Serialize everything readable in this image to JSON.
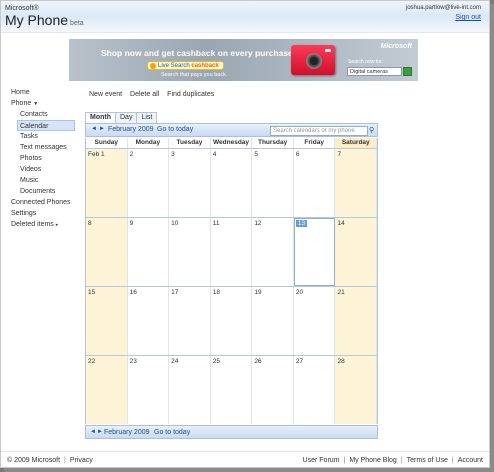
{
  "header": {
    "brand_prefix": "Microsoft®",
    "brand_name": "My Phone",
    "brand_tag": "beta",
    "user_email": "joshua.partlow@live-int.com",
    "signout": "Sign out"
  },
  "ad": {
    "headline": "Shop now and get cashback on every purchase.",
    "pill_prefix": "Live Search",
    "pill_suffix": "cashback",
    "tagline": "Search that pays you back.",
    "brand": "Microsoft",
    "search_label": "Search now for:",
    "search_value": "Digital cameras"
  },
  "sidebar": {
    "items": [
      {
        "label": "Home"
      },
      {
        "label": "Phone",
        "caret": "▼"
      },
      {
        "label": "Contacts"
      },
      {
        "label": "Calendar"
      },
      {
        "label": "Tasks"
      },
      {
        "label": "Text messages"
      },
      {
        "label": "Photos"
      },
      {
        "label": "Videos"
      },
      {
        "label": "Music"
      },
      {
        "label": "Documents"
      },
      {
        "label": "Connected Phones"
      },
      {
        "label": "Settings"
      },
      {
        "label": "Deleted items",
        "caret": "▸"
      }
    ]
  },
  "actions": {
    "new_event": "New event",
    "delete_all": "Delete all",
    "find_duplicates": "Find duplicates"
  },
  "calendar": {
    "tabs": [
      "Month",
      "Day",
      "List"
    ],
    "month_label": "February 2009",
    "go_today": "Go to today",
    "search_placeholder": "Search calendars or my phone",
    "weekdays": [
      "Sunday",
      "Monday",
      "Tuesday",
      "Wednesday",
      "Thursday",
      "Friday",
      "Saturday"
    ],
    "weeks": [
      [
        "Feb 1",
        "2",
        "3",
        "4",
        "5",
        "6",
        "7"
      ],
      [
        "8",
        "9",
        "10",
        "11",
        "12",
        "13",
        "14"
      ],
      [
        "15",
        "16",
        "17",
        "18",
        "19",
        "20",
        "21"
      ],
      [
        "22",
        "23",
        "24",
        "25",
        "26",
        "27",
        "28"
      ]
    ],
    "today": "13"
  },
  "footer": {
    "copyright": "© 2009 Microsoft",
    "privacy": "Privacy",
    "links": [
      "User Forum",
      "My Phone Blog",
      "Terms of Use",
      "Account"
    ]
  }
}
